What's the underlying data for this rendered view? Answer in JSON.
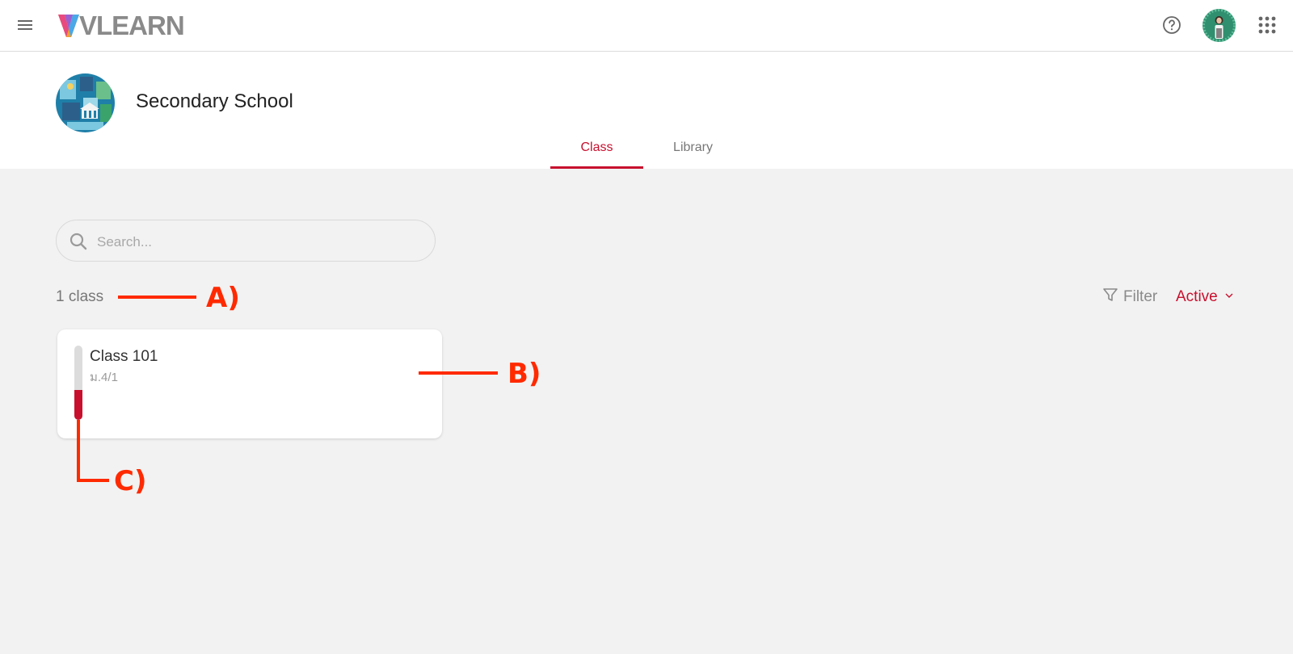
{
  "topbar": {
    "logo_text": "VLEARN",
    "icons": {
      "menu": "hamburger-menu-icon",
      "help": "help-circle-icon",
      "avatar": "user-avatar",
      "apps": "apps-grid-icon"
    }
  },
  "header": {
    "school_name": "Secondary School",
    "tabs": [
      {
        "label": "Class",
        "active": true
      },
      {
        "label": "Library",
        "active": false
      }
    ]
  },
  "search": {
    "placeholder": "Search..."
  },
  "count_text": "1 class",
  "filter": {
    "label": "Filter",
    "status_value": "Active"
  },
  "classes": [
    {
      "name": "Class 101",
      "subtitle": "ม.4/1",
      "progress_fraction": 0.4
    }
  ],
  "annotations": {
    "a": "A)",
    "b": "B)",
    "c": "C)"
  },
  "colors": {
    "accent": "#c8102e",
    "annotation": "#ff2a00"
  }
}
